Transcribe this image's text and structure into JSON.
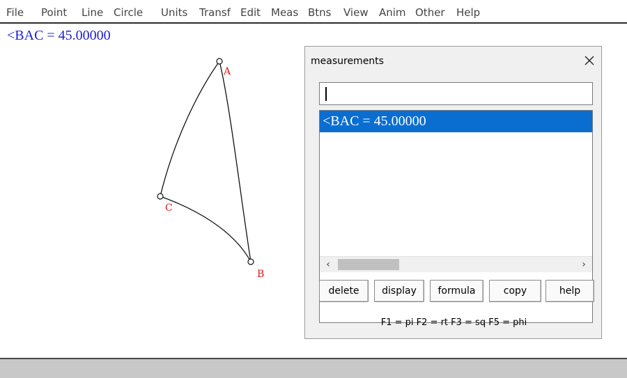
{
  "menu": [
    "File",
    "Point",
    "Line",
    "Circle",
    "Units",
    "Transf",
    "Edit",
    "Meas",
    "Btns",
    "View",
    "Anim",
    "Other",
    "Help"
  ],
  "canvas": {
    "readout": "<BAC = 45.00000",
    "points": [
      {
        "label": "A"
      },
      {
        "label": "B"
      },
      {
        "label": "C"
      }
    ]
  },
  "dialog": {
    "title": "measurements",
    "input_value": "",
    "items": [
      "<BAC = 45.00000"
    ],
    "buttons": [
      "delete",
      "display",
      "formula",
      "copy",
      "help"
    ],
    "function_keys": "F1 = pi   F2 = rt   F3 = sq   F5 = phi"
  },
  "colors": {
    "readout": "#1c1cd8",
    "point_label": "#e01818",
    "selection": "#0a6ed1"
  }
}
